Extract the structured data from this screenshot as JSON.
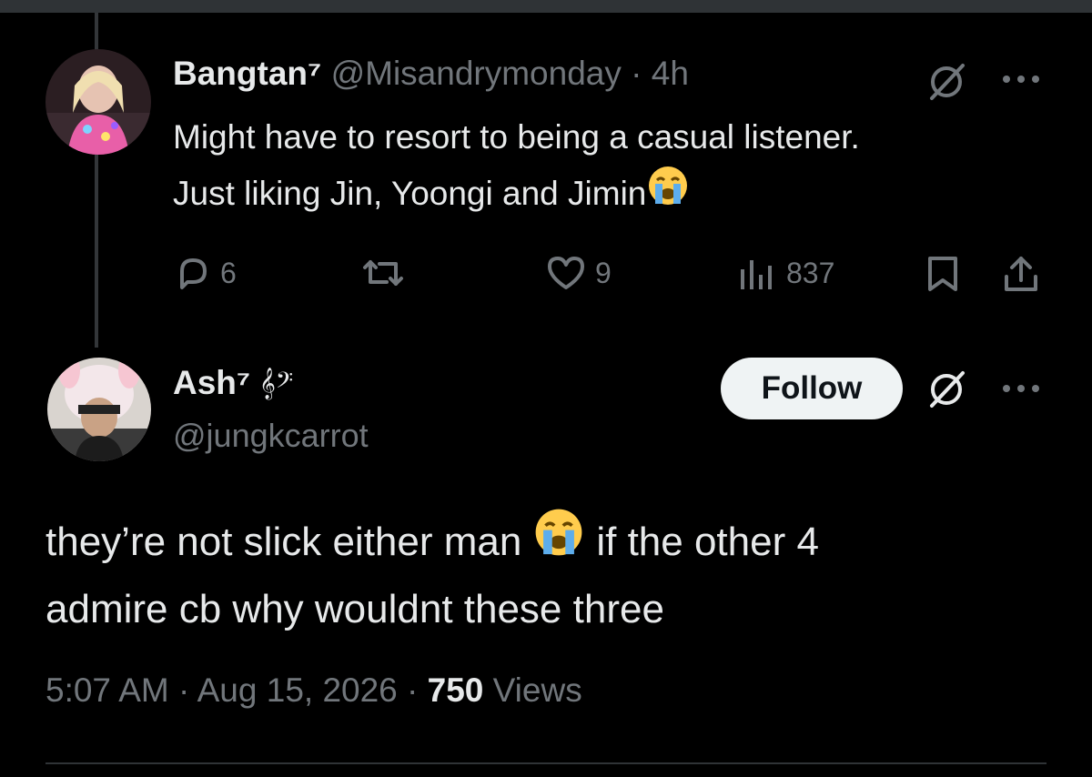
{
  "parent_post": {
    "display_name": "Bangtan⁷",
    "handle": "@Misandrymonday",
    "separator": "·",
    "time_ago": "4h",
    "text_line1": "Might have to resort to being a casual listener.",
    "text_line2": "Just liking Jin, Yoongi and Jimin",
    "emoji": "loudly-crying-face",
    "replies": "6",
    "likes": "9",
    "views": "837"
  },
  "main_post": {
    "display_name": "Ash⁷",
    "name_badge": "𝄞𝄢",
    "handle": "@jungkcarrot",
    "follow_label": "Follow",
    "text_line1a": "they’re not slick either man",
    "text_line1b": "if the other 4",
    "text_line2": "admire cb why wouldnt these three",
    "time": "5:07 AM",
    "date": "Aug 15, 2026",
    "dot": "·",
    "views_count": "750",
    "views_label": "Views"
  },
  "colors": {
    "background": "#000000",
    "text": "#e7e9ea",
    "muted": "#71767b",
    "follow_bg": "#eff3f4"
  }
}
